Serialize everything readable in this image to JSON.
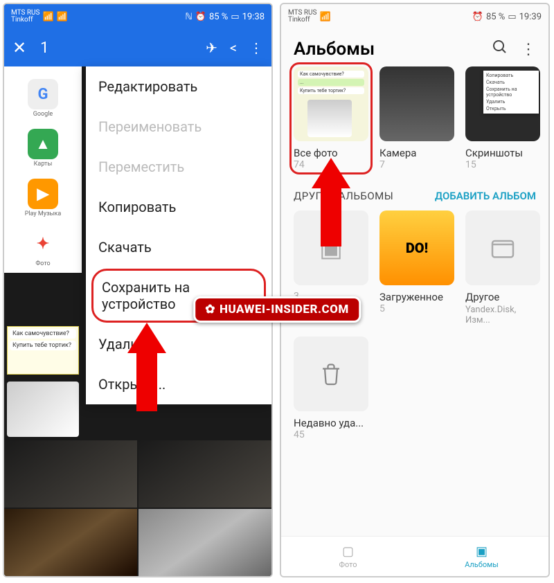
{
  "status": {
    "carrier1": "MTS RUS",
    "carrier2": "Tinkoff",
    "battery": "85 %",
    "time_left": "19:38",
    "time_right": "19:39"
  },
  "left": {
    "selected_count": "1",
    "apps": [
      {
        "label": "Google",
        "glyph": "G"
      },
      {
        "label": "Карты",
        "glyph": "▲"
      },
      {
        "label": "Play Музыка",
        "glyph": "▶"
      },
      {
        "label": "Фото",
        "glyph": "✦"
      }
    ],
    "chat": {
      "line1": "Как самочувствие?",
      "line2": "Купить тебе тортик?"
    },
    "menu": {
      "edit": "Редактировать",
      "rename": "Переименовать",
      "move": "Переместить",
      "copy": "Копировать",
      "download": "Скачать",
      "save_device": "Сохранить на устройство",
      "delete": "Удалить",
      "open": "Открыть..."
    }
  },
  "right": {
    "title": "Альбомы",
    "albums": [
      {
        "title": "Все фото",
        "count": "74"
      },
      {
        "title": "Камера",
        "count": "7"
      },
      {
        "title": "Скриншоты",
        "count": "15"
      }
    ],
    "screenshot_menu": [
      "Копировать",
      "Скачать",
      "Сохранить на устройство",
      "Удалить",
      "Открыть"
    ],
    "section_label": "ДРУГИЕ АЛЬБОМЫ",
    "add_album": "ДОБАВИТЬ АЛЬБОМ",
    "other": [
      {
        "title": "",
        "count": "3"
      },
      {
        "title": "Загруженное",
        "count": "5"
      },
      {
        "title": "Другое",
        "sub": "Yandex.Disk, Изм..."
      },
      {
        "title": "Недавно уда...",
        "count": "45"
      }
    ],
    "tabs": {
      "photo": "Фото",
      "albums": "Альбомы"
    }
  },
  "watermark": "HUAWEI-INSIDER.COM"
}
